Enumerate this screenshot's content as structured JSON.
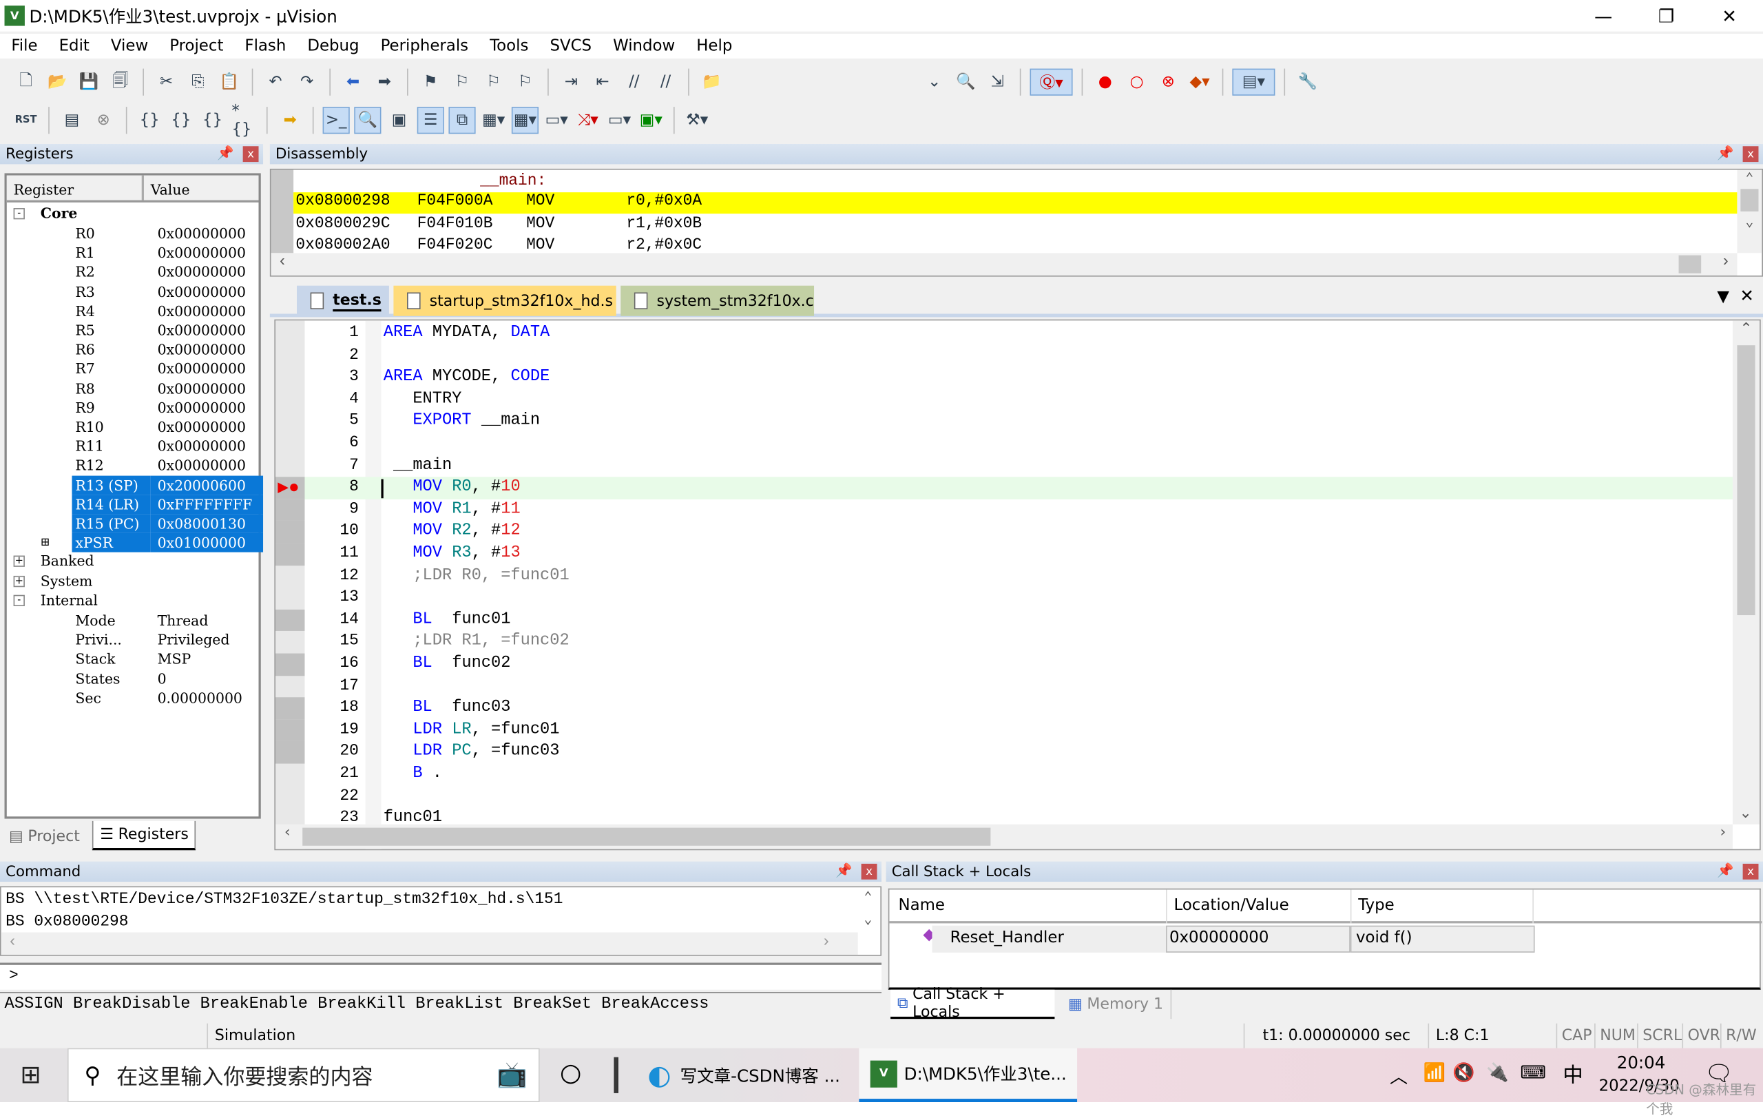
{
  "window": {
    "title": "D:\\MDK5\\作业3\\test.uvprojx - µVision",
    "app_icon": "uvision-icon",
    "minimize": "—",
    "restore": "❐",
    "close": "✕"
  },
  "menu": [
    "File",
    "Edit",
    "View",
    "Project",
    "Flash",
    "Debug",
    "Peripherals",
    "Tools",
    "SVCS",
    "Window",
    "Help"
  ],
  "registers": {
    "title": "Registers",
    "col_register": "Register",
    "col_value": "Value",
    "core_label": "Core",
    "core": [
      [
        "R0",
        "0x00000000"
      ],
      [
        "R1",
        "0x00000000"
      ],
      [
        "R2",
        "0x00000000"
      ],
      [
        "R3",
        "0x00000000"
      ],
      [
        "R4",
        "0x00000000"
      ],
      [
        "R5",
        "0x00000000"
      ],
      [
        "R6",
        "0x00000000"
      ],
      [
        "R7",
        "0x00000000"
      ],
      [
        "R8",
        "0x00000000"
      ],
      [
        "R9",
        "0x00000000"
      ],
      [
        "R10",
        "0x00000000"
      ],
      [
        "R11",
        "0x00000000"
      ],
      [
        "R12",
        "0x00000000"
      ],
      [
        "R13 (SP)",
        "0x20000600"
      ],
      [
        "R14 (LR)",
        "0xFFFFFFFF"
      ],
      [
        "R15 (PC)",
        "0x08000130"
      ],
      [
        "xPSR",
        "0x01000000"
      ]
    ],
    "groups": [
      "Banked",
      "System",
      "Internal"
    ],
    "internal": [
      [
        "Mode",
        "Thread"
      ],
      [
        "Privi...",
        "Privileged"
      ],
      [
        "Stack",
        "MSP"
      ],
      [
        "States",
        "0"
      ],
      [
        "Sec",
        "0.00000000"
      ]
    ],
    "tabs": [
      "Project",
      "Registers"
    ]
  },
  "disassembly": {
    "title": "Disassembly",
    "label": "__main:",
    "rows": [
      [
        "0x08000298",
        "F04F000A",
        "MOV",
        "r0,#0x0A"
      ],
      [
        "0x0800029C",
        "F04F010B",
        "MOV",
        "r1,#0x0B"
      ],
      [
        "0x080002A0",
        "F04F020C",
        "MOV",
        "r2,#0x0C"
      ]
    ]
  },
  "editor": {
    "tabs": [
      "test.s",
      "startup_stm32f10x_hd.s",
      "system_stm32f10x.c"
    ],
    "lines": [
      [
        [
          "AREA",
          "kw"
        ],
        [
          " MYDATA, ",
          "lb"
        ],
        [
          "DATA",
          "kw"
        ]
      ],
      [],
      [
        [
          "AREA",
          "kw"
        ],
        [
          " MYCODE, ",
          "lb"
        ],
        [
          "CODE",
          "kw"
        ]
      ],
      [
        [
          "   ENTRY",
          "lb"
        ]
      ],
      [
        [
          "   EXPORT",
          "kw"
        ],
        [
          " __main",
          "lb"
        ]
      ],
      [],
      [
        [
          " __main",
          "lb"
        ]
      ],
      [
        [
          "   MOV",
          "kw"
        ],
        [
          " ",
          "lb"
        ],
        [
          "R0",
          "rg"
        ],
        [
          ", #",
          "lb"
        ],
        [
          "10",
          "nm"
        ]
      ],
      [
        [
          "   MOV",
          "kw"
        ],
        [
          " ",
          "lb"
        ],
        [
          "R1",
          "rg"
        ],
        [
          ", #",
          "lb"
        ],
        [
          "11",
          "nm"
        ]
      ],
      [
        [
          "   MOV",
          "kw"
        ],
        [
          " ",
          "lb"
        ],
        [
          "R2",
          "rg"
        ],
        [
          ", #",
          "lb"
        ],
        [
          "12",
          "nm"
        ]
      ],
      [
        [
          "   MOV",
          "kw"
        ],
        [
          " ",
          "lb"
        ],
        [
          "R3",
          "rg"
        ],
        [
          ", #",
          "lb"
        ],
        [
          "13",
          "nm"
        ]
      ],
      [
        [
          "   ;LDR R0, =func01",
          "cm"
        ]
      ],
      [],
      [
        [
          "   BL",
          "kw"
        ],
        [
          "  func01",
          "lb"
        ]
      ],
      [
        [
          "   ;LDR R1, =func02",
          "cm"
        ]
      ],
      [
        [
          "   BL",
          "kw"
        ],
        [
          "  func02",
          "lb"
        ]
      ],
      [],
      [
        [
          "   BL",
          "kw"
        ],
        [
          "  func03",
          "lb"
        ]
      ],
      [
        [
          "   LDR",
          "kw"
        ],
        [
          " ",
          "lb"
        ],
        [
          "LR",
          "rg"
        ],
        [
          ", =func01",
          "lb"
        ]
      ],
      [
        [
          "   LDR",
          "kw"
        ],
        [
          " ",
          "lb"
        ],
        [
          "PC",
          "rg"
        ],
        [
          ", =func03",
          "lb"
        ]
      ],
      [
        [
          "   B",
          "kw"
        ],
        [
          " .",
          "lb"
        ]
      ],
      [],
      [
        [
          "func01",
          "lb"
        ]
      ]
    ]
  },
  "command": {
    "title": "Command",
    "output": [
      "BS \\\\test\\RTE/Device/STM32F103ZE/startup_stm32f10x_hd.s\\151",
      "BS 0x08000298"
    ],
    "prompt": ">",
    "hints": "ASSIGN BreakDisable BreakEnable BreakKill BreakList BreakSet BreakAccess"
  },
  "callstack": {
    "title": "Call Stack + Locals",
    "cols": [
      "Name",
      "Location/Value",
      "Type"
    ],
    "rows": [
      [
        "Reset_Handler",
        "0x00000000",
        "void f()"
      ]
    ],
    "tabs": [
      "Call Stack + Locals",
      "Memory 1"
    ]
  },
  "status": {
    "mode": "Simulation",
    "time": "t1: 0.00000000 sec",
    "pos": "L:8 C:1",
    "flags": [
      "CAP",
      "NUM",
      "SCRL",
      "OVR",
      "R/W"
    ]
  },
  "taskbar": {
    "search_placeholder": "在这里输入你要搜索的内容",
    "apps": [
      "写文章-CSDN博客 ...",
      "D:\\MDK5\\作业3\\te..."
    ],
    "time": "20:04",
    "date": "2022/9/30",
    "ime": "中",
    "watermark": "CSDN @森林里有个我"
  },
  "colors": {
    "exec_line": "#ffff00",
    "current_line": "#e8fbe8",
    "selection": "#0a78d7",
    "breakpoint": "#ff0000"
  }
}
